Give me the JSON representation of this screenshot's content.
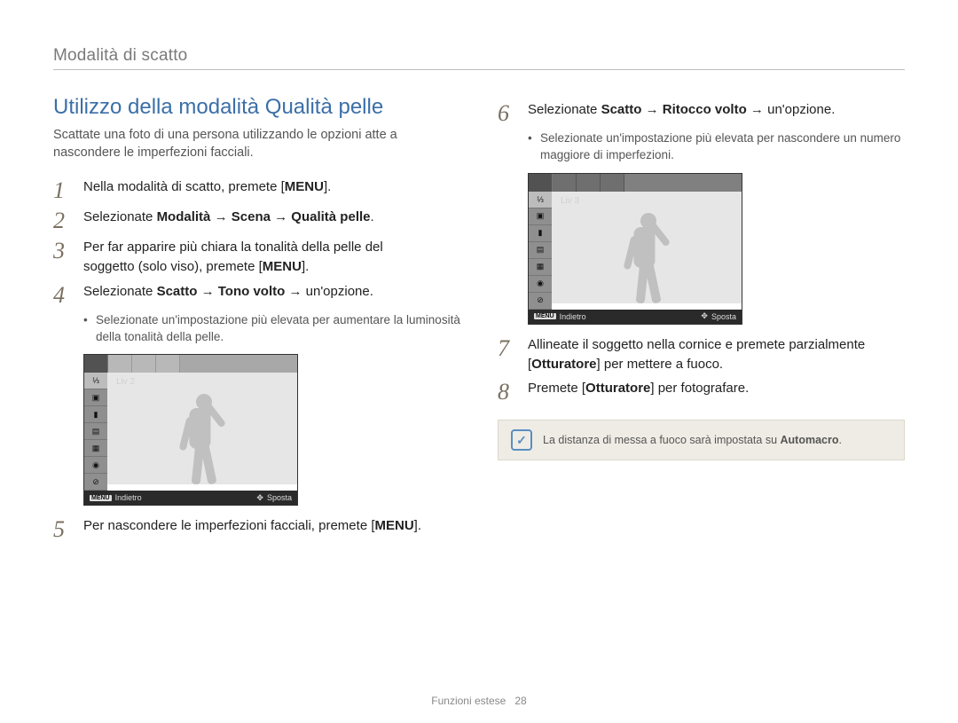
{
  "header": {
    "title": "Modalità di scatto"
  },
  "section": {
    "heading": "Utilizzo della modalità Qualità pelle"
  },
  "intro": "Scattate una foto di una persona utilizzando le opzioni atte a nascondere le imperfezioni facciali.",
  "steps": {
    "s1": {
      "num": "1",
      "pre": "Nella modalità di scatto, premete [",
      "key": "MENU",
      "post": "]."
    },
    "s2": {
      "num": "2",
      "pre": "Selezionate ",
      "b1": "Modalità",
      "arr1": " → ",
      "b2": "Scena",
      "arr2": " → ",
      "b3": "Qualità pelle",
      "post": "."
    },
    "s3": {
      "num": "3",
      "line1": "Per far apparire più chiara la tonalità della pelle del",
      "line2_pre": "soggetto (solo viso), premete [",
      "key": "MENU",
      "line2_post": "]."
    },
    "s4": {
      "num": "4",
      "pre": "Selezionate ",
      "b1": "Scatto",
      "arr1": " → ",
      "b2": "Tono volto",
      "arr2": " → un'opzione.",
      "sub": "Selezionate un'impostazione più elevata per aumentare la luminosità della tonalità della pelle."
    },
    "s5": {
      "num": "5",
      "pre": "Per nascondere le imperfezioni facciali, premete [",
      "key": "MENU",
      "post": "]."
    },
    "s6": {
      "num": "6",
      "pre": "Selezionate ",
      "b1": "Scatto",
      "arr1": " → ",
      "b2": "Ritocco volto",
      "arr2": " → un'opzione.",
      "sub": "Selezionate un'impostazione più elevata per nascondere un numero maggiore di imperfezioni."
    },
    "s7": {
      "num": "7",
      "line1": "Allineate il soggetto nella cornice e premete parzialmente",
      "line2_pre": "[",
      "b": "Otturatore",
      "line2_post": "] per mettere a fuoco."
    },
    "s8": {
      "num": "8",
      "pre": "Premete [",
      "b": "Otturatore",
      "post": "] per fotografare."
    }
  },
  "lcd1": {
    "label": "Liv 2",
    "footer": {
      "menu": "MENU",
      "back": "Indietro",
      "move": "Sposta"
    }
  },
  "lcd2": {
    "label": "Liv 3",
    "footer": {
      "menu": "MENU",
      "back": "Indietro",
      "move": "Sposta"
    }
  },
  "note": {
    "icon": "✓",
    "pre": "La distanza di messa a fuoco sarà impostata su ",
    "b": "Automacro",
    "post": "."
  },
  "footer": {
    "label": "Funzioni estese",
    "page": "28"
  }
}
